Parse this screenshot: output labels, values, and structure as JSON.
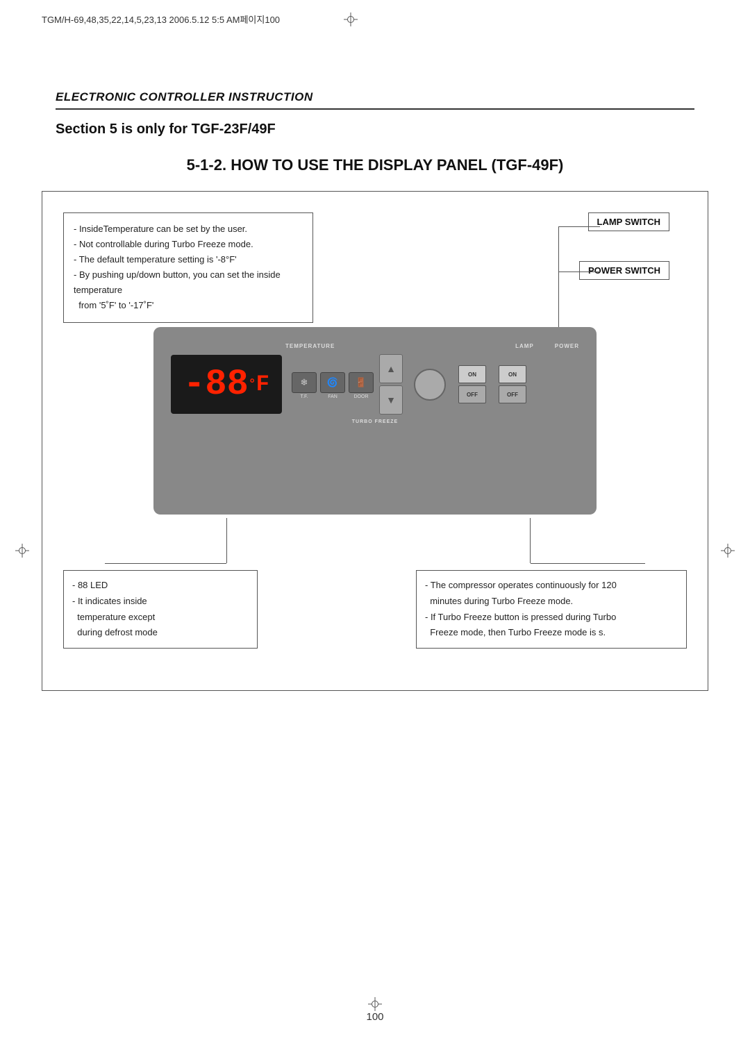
{
  "page": {
    "header_text": "TGM/H-69,48,35,22,14,5,23,13  2006.5.12 5:5 AM페이지100",
    "page_number": "100"
  },
  "section": {
    "title": "ELECTRONIC CONTROLLER INSTRUCTION",
    "subtitle": "Section 5 is only for TGF-23F/49F",
    "heading": "5-1-2. HOW TO USE THE DISPLAY PANEL (TGF-49F)"
  },
  "callout_top": {
    "lines": [
      "- InsideTemperature can be set by the user.",
      "- Not controllable during Turbo Freeze mode.",
      "- The default temperature setting is '-8°F'",
      "- By pushing up/down button, you can set the inside temperature",
      "  from '5˚F' to '-17˚F'"
    ]
  },
  "labels": {
    "lamp_switch": "LAMP SWITCH",
    "power_switch": "POWER SWITCH",
    "temperature": "TEMPERATURE",
    "lamp": "LAMP",
    "power": "POWER",
    "turbo_freeze": "TURBO FREEZE",
    "tf": "T.F.",
    "fan": "FAN",
    "door": "DOOR",
    "on": "ON",
    "off": "OFF"
  },
  "display": {
    "value": "-88",
    "unit": "°F"
  },
  "callout_bottom_left": {
    "lines": [
      "- 88 LED",
      "- It indicates inside",
      "  temperature except",
      "  during defrost mode"
    ]
  },
  "callout_bottom_right": {
    "lines": [
      "- The compressor operates continuously for 120",
      "  minutes during Turbo Freeze mode.",
      "- If Turbo Freeze button is pressed during Turbo",
      "  Freeze mode, then Turbo Freeze mode is s."
    ]
  }
}
